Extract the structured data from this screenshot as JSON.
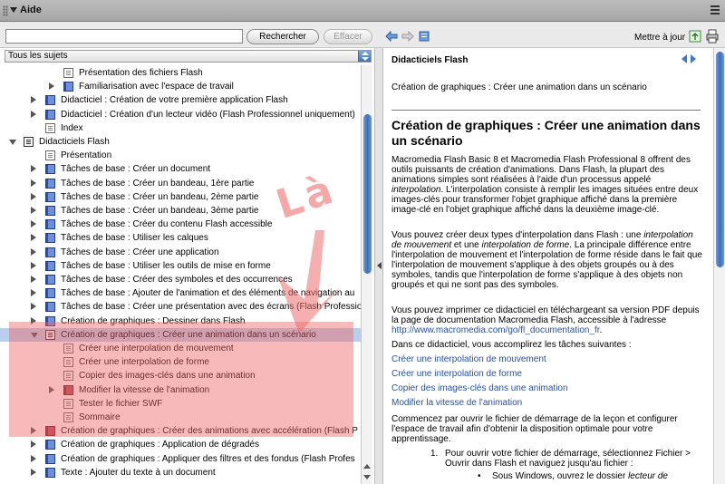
{
  "window": {
    "title": "Aide"
  },
  "toolbar": {
    "search_placeholder": "",
    "search_button": "Rechercher",
    "clear_button": "Effacer",
    "update_label": "Mettre à jour"
  },
  "filter": {
    "selected": "Tous les sujets"
  },
  "tree": [
    {
      "label": "Présentation des fichiers Flash",
      "icon": "page",
      "level": 3,
      "toggle": "none"
    },
    {
      "label": "Familiarisation avec l'espace de travail",
      "icon": "book",
      "level": 3,
      "toggle": "right"
    },
    {
      "label": "Didacticiel : Création de votre première application Flash",
      "icon": "book",
      "level": 2,
      "toggle": "right"
    },
    {
      "label": "Didacticiel : Création d'un lecteur vidéo (Flash Professionnel uniquement)",
      "icon": "book",
      "level": 2,
      "toggle": "right"
    },
    {
      "label": "Index",
      "icon": "page",
      "level": 2,
      "toggle": "none"
    },
    {
      "label": "Didacticiels Flash",
      "icon": "openbook",
      "level": 1,
      "toggle": "down"
    },
    {
      "label": "Présentation",
      "icon": "page",
      "level": 2,
      "toggle": "none"
    },
    {
      "label": "Tâches de base : Créer un document",
      "icon": "book",
      "level": 2,
      "toggle": "right"
    },
    {
      "label": "Tâches de base : Créer un bandeau, 1ère partie",
      "icon": "book",
      "level": 2,
      "toggle": "right"
    },
    {
      "label": "Tâches de base : Créer un bandeau, 2ème partie",
      "icon": "book",
      "level": 2,
      "toggle": "right"
    },
    {
      "label": "Tâches de base : Créer un bandeau, 3ème partie",
      "icon": "book",
      "level": 2,
      "toggle": "right"
    },
    {
      "label": "Tâches de base : Créer du contenu Flash accessible",
      "icon": "book",
      "level": 2,
      "toggle": "right"
    },
    {
      "label": "Tâches de base : Utiliser les calques",
      "icon": "book",
      "level": 2,
      "toggle": "right"
    },
    {
      "label": "Tâches de base : Créer une application",
      "icon": "book",
      "level": 2,
      "toggle": "right"
    },
    {
      "label": "Tâches de base : Utiliser les outils de mise en forme",
      "icon": "book",
      "level": 2,
      "toggle": "right"
    },
    {
      "label": "Tâches de base : Créer des symboles et des occurrences",
      "icon": "book",
      "level": 2,
      "toggle": "right"
    },
    {
      "label": "Tâches de base : Ajouter de l'animation et des éléments de navigation au",
      "icon": "book",
      "level": 2,
      "toggle": "right"
    },
    {
      "label": "Tâches de base : Créer une présentation avec des écrans (Flash Professio",
      "icon": "book",
      "level": 2,
      "toggle": "right"
    },
    {
      "label": "Création de graphiques : Dessiner dans Flash",
      "icon": "book",
      "level": 2,
      "toggle": "right"
    },
    {
      "label": "Création de graphiques : Créer une animation dans un scénario",
      "icon": "openbook",
      "level": 2,
      "toggle": "down",
      "selected": true
    },
    {
      "label": "Créer une interpolation de mouvement",
      "icon": "page",
      "level": 3,
      "toggle": "none"
    },
    {
      "label": "Créer une interpolation de forme",
      "icon": "page",
      "level": 3,
      "toggle": "none"
    },
    {
      "label": "Copier des images-clés dans une animation",
      "icon": "page",
      "level": 3,
      "toggle": "none"
    },
    {
      "label": "Modifier la vitesse de l'animation",
      "icon": "redbook",
      "level": 3,
      "toggle": "right"
    },
    {
      "label": "Tester le fichier SWF",
      "icon": "page",
      "level": 3,
      "toggle": "none"
    },
    {
      "label": "Sommaire",
      "icon": "page",
      "level": 3,
      "toggle": "none"
    },
    {
      "label": "Création de graphiques : Créer des animations avec accélération (Flash P",
      "icon": "redbook",
      "level": 2,
      "toggle": "right"
    },
    {
      "label": "Création de graphiques : Application de dégradés",
      "icon": "book",
      "level": 2,
      "toggle": "right"
    },
    {
      "label": "Création de graphiques : Appliquer des filtres et des fondus (Flash Profes",
      "icon": "book",
      "level": 2,
      "toggle": "right"
    },
    {
      "label": "Texte : Ajouter du texte à un document",
      "icon": "book",
      "level": 2,
      "toggle": "right"
    }
  ],
  "annotation": {
    "text": "Là"
  },
  "content": {
    "header": "Didacticiels Flash",
    "breadcrumb": "Création de graphiques : Créer une animation dans un scénario",
    "title": "Création de graphiques : Créer une animation dans un scénario",
    "p1_a": "Macromedia Flash Basic 8 et Macromedia Flash Professional 8 offrent des outils puissants de création d'animations. Dans Flash, la plupart des animations simples sont réalisées à l'aide d'un processus appelé ",
    "p1_em": "interpolation",
    "p1_b": ". L'interpolation consiste à remplir les images situées entre deux images-clés pour transformer l'objet graphique affiché dans la première image-clé en l'objet graphique affiché dans la deuxième image-clé.",
    "p2_a": "Vous pouvez créer deux types d'interpolation dans Flash : une ",
    "p2_em1": "interpolation de mouvement",
    "p2_b": " et une ",
    "p2_em2": "interpolation de forme",
    "p2_c": ". La principale différence entre l'interpolation de mouvement et l'interpolation de forme réside dans le fait que l'interpolation de mouvement s'applique à des objets groupés ou à des symboles, tandis que l'interpolation de forme s'applique à des objets non groupés et qui ne sont pas des symboles.",
    "p3_a": "Vous pouvez imprimer ce didacticiel en téléchargeant sa version PDF depuis la page de documentation Macromedia Flash, accessible à l'adresse ",
    "p3_url": "http://www.macromedia.com/go/fl_documentation_fr",
    "p3_b": ".",
    "p4": "Dans ce didacticiel, vous accomplirez les tâches suivantes :",
    "links": [
      "Créer une interpolation de mouvement",
      "Créer une interpolation de forme",
      "Copier des images-clés dans une animation",
      "Modifier la vitesse de l'animation"
    ],
    "p5": "Commencez par ouvrir le fichier de démarrage de la leçon et configurer l'espace de travail afin d'obtenir la disposition optimale pour votre apprentissage.",
    "step1_num": "1.",
    "step1": "Pour ouvrir votre fichier de démarrage, sélectionnez Fichier > Ouvrir dans Flash et naviguez jusqu'au fichier :",
    "bullet1_a": "Sous Windows, ouvrez le dossier ",
    "bullet1_em": "lecteur de"
  },
  "colors": {
    "accent": "#3e78c8",
    "selection": "#b8d0ee",
    "annotation": "#ee6464"
  }
}
